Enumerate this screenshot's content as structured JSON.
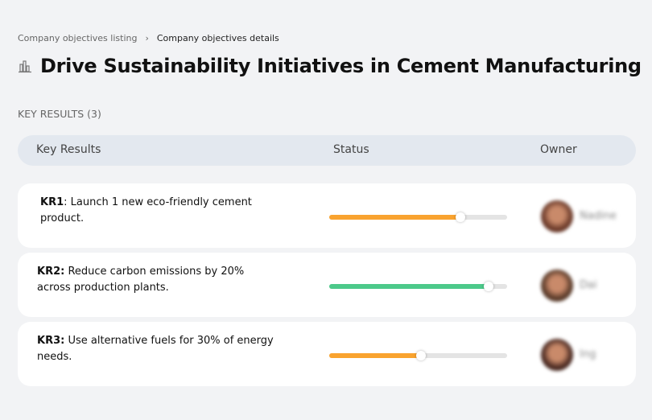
{
  "breadcrumb": {
    "items": [
      "Company objectives listing",
      "Company objectives details"
    ],
    "separator": "›"
  },
  "page": {
    "title": "Drive Sustainability Initiatives in Cement Manufacturing",
    "icon": "building-chart-icon"
  },
  "section": {
    "label": "KEY RESULTS (3)"
  },
  "table": {
    "headers": [
      "Key Results",
      "Status",
      "Owner"
    ],
    "rows": [
      {
        "id": "KR1",
        "text": ": Launch 1 new eco-friendly cement product.",
        "progress": 74,
        "color": "#f9a32f",
        "owner": "Nadine",
        "avatar_color": "#6b3a2a"
      },
      {
        "id": "KR2:",
        "text": " Reduce carbon emissions by 20% across production plants.",
        "progress": 90,
        "color": "#4cc98a",
        "owner": "Dai",
        "avatar_color": "#5a3b2a"
      },
      {
        "id": "KR3:",
        "text": " Use alternative fuels for 30% of energy needs.",
        "progress": 52,
        "color": "#f9a32f",
        "owner": "Ing",
        "avatar_color": "#4a2a22"
      }
    ]
  }
}
